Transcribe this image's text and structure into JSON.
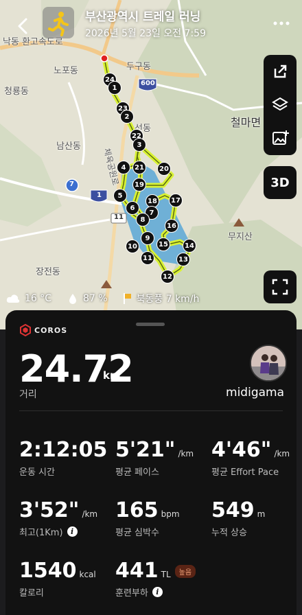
{
  "header": {
    "title": "부산광역시 트레일 러닝",
    "date": "2026년 5월 23일 오전 7:59"
  },
  "map": {
    "labels": {
      "highway": "낙동 환고속도로",
      "nopo": "노포동",
      "dugu": "두구동",
      "cheongryong": "청룡동",
      "namsan": "남산동",
      "cheolma": "철마면",
      "seon": "선동",
      "road_name": "체육공원로",
      "jangjeon": "장전동",
      "mujisan": "무지산",
      "road_7": "7",
      "road_1": "1",
      "road_11": "11",
      "road_600": "600"
    },
    "route_markers": [
      "24",
      "1",
      "23",
      "2",
      "22",
      "3",
      "21",
      "20",
      "4",
      "19",
      "5",
      "18",
      "17",
      "6",
      "7",
      "8",
      "16",
      "9",
      "15",
      "14",
      "10",
      "11",
      "13",
      "12"
    ],
    "route_color": "#d9f233",
    "water_color": "#6fb0d6"
  },
  "tools": {
    "share_icon": "share-icon",
    "layers_icon": "layers-icon",
    "image_add_icon": "image-add-icon",
    "btn_3d": "3D",
    "fullscreen_icon": "fullscreen-icon"
  },
  "weather": {
    "temp": "16 °C",
    "humidity": "87 %",
    "wind": "북동풍 7 km/h"
  },
  "activity": {
    "brand": "COROS",
    "distance": "24.72",
    "distance_unit": "km",
    "distance_label": "거리",
    "username": "midigama",
    "stats": [
      {
        "value": "2:12:05",
        "unit": "",
        "label": "운동 시간"
      },
      {
        "value": "5'21\"",
        "unit": "/km",
        "label": "평균 페이스"
      },
      {
        "value": "4'46\"",
        "unit": "/km",
        "label": "평균 Effort Pace"
      },
      {
        "value": "3'52\"",
        "unit": "/km",
        "label": "최고(1Km)"
      },
      {
        "value": "165",
        "unit": "bpm",
        "label": "평균 심박수"
      },
      {
        "value": "549",
        "unit": "m",
        "label": "누적 상승"
      },
      {
        "value": "1540",
        "unit": "kcal",
        "label": "칼로리"
      },
      {
        "value": "441",
        "unit": "TL",
        "label": "훈련부하",
        "badge": "높음"
      }
    ]
  }
}
